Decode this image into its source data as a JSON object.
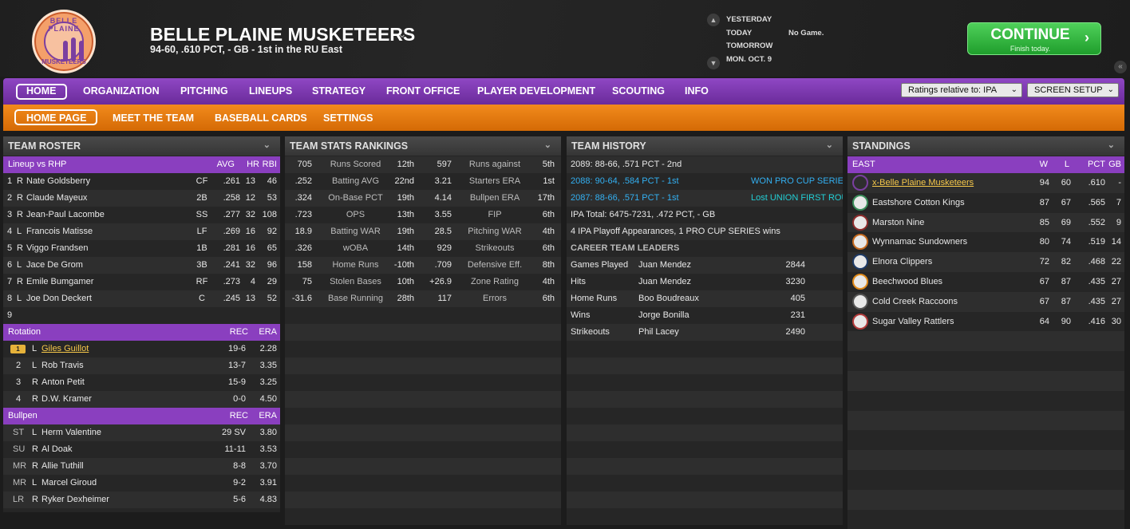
{
  "header": {
    "team_name": "BELLE PLAINE MUSKETEERS",
    "record": "94-60, .610 PCT, - GB - 1st in the RU East",
    "logo_text_top": "BELLE PLAINE",
    "logo_text_bottom": "MUSKETEERS",
    "days": [
      "YESTERDAY",
      "TODAY",
      "TOMORROW",
      "MON. OCT. 9"
    ],
    "today_status": "No Game.",
    "continue_label": "CONTINUE",
    "continue_sub": "Finish today."
  },
  "nav": {
    "main": [
      "HOME",
      "ORGANIZATION",
      "PITCHING",
      "LINEUPS",
      "STRATEGY",
      "FRONT OFFICE",
      "PLAYER DEVELOPMENT",
      "SCOUTING",
      "INFO"
    ],
    "ratings_select": "Ratings relative to: IPA",
    "screen_setup": "SCREEN SETUP",
    "sub": [
      "HOME PAGE",
      "MEET THE TEAM",
      "BASEBALL CARDS",
      "SETTINGS"
    ]
  },
  "colors": {
    "purple": "#8a3fbf",
    "orange": "#e57b10",
    "green": "#2fb53c",
    "link": "#f6c84a"
  },
  "roster": {
    "title": "TEAM ROSTER",
    "lineup_label": "Lineup vs RHP",
    "cols": [
      "AVG",
      "HR",
      "RBI"
    ],
    "lineup": [
      [
        "1",
        "R",
        "Nate Goldsberry",
        "CF",
        ".261",
        "13",
        "46"
      ],
      [
        "2",
        "R",
        "Claude Mayeux",
        "2B",
        ".258",
        "12",
        "53"
      ],
      [
        "3",
        "R",
        "Jean-Paul Lacombe",
        "SS",
        ".277",
        "32",
        "108"
      ],
      [
        "4",
        "L",
        "Francois Matisse",
        "LF",
        ".269",
        "16",
        "92"
      ],
      [
        "5",
        "R",
        "Viggo Frandsen",
        "1B",
        ".281",
        "16",
        "65"
      ],
      [
        "6",
        "L",
        "Jace De Grom",
        "3B",
        ".241",
        "32",
        "96"
      ],
      [
        "7",
        "R",
        "Emile Bumgamer",
        "RF",
        ".273",
        "4",
        "29"
      ],
      [
        "8",
        "L",
        "Joe Don Deckert",
        "C",
        ".245",
        "13",
        "52"
      ],
      [
        "9",
        "",
        "",
        "",
        "",
        "",
        ""
      ]
    ],
    "rotation_label": "Rotation",
    "rot_cols": [
      "REC",
      "ERA"
    ],
    "rotation": [
      [
        "1",
        "L",
        "Giles Guillot",
        "19-6",
        "2.28"
      ],
      [
        "2",
        "L",
        "Rob Travis",
        "13-7",
        "3.35"
      ],
      [
        "3",
        "R",
        "Anton Petit",
        "15-9",
        "3.25"
      ],
      [
        "4",
        "R",
        "D.W. Kramer",
        "0-0",
        "4.50"
      ]
    ],
    "bullpen_label": "Bullpen",
    "bullpen": [
      [
        "ST",
        "L",
        "Herm Valentine",
        "29 SV",
        "3.80"
      ],
      [
        "SU",
        "R",
        "Al Doak",
        "11-11",
        "3.53"
      ],
      [
        "MR",
        "R",
        "Allie Tuthill",
        "8-8",
        "3.70"
      ],
      [
        "MR",
        "L",
        "Marcel Giroud",
        "9-2",
        "3.91"
      ],
      [
        "LR",
        "R",
        "Ryker Dexheimer",
        "5-6",
        "4.83"
      ]
    ]
  },
  "stats": {
    "title": "TEAM STATS RANKINGS",
    "rows": [
      [
        "705",
        "Runs Scored",
        "12th",
        "597",
        "Runs against",
        "5th"
      ],
      [
        ".252",
        "Batting AVG",
        "22nd",
        "3.21",
        "Starters ERA",
        "1st"
      ],
      [
        ".324",
        "On-Base PCT",
        "19th",
        "4.14",
        "Bullpen ERA",
        "17th"
      ],
      [
        ".723",
        "OPS",
        "13th",
        "3.55",
        "FIP",
        "6th"
      ],
      [
        "18.9",
        "Batting WAR",
        "19th",
        "28.5",
        "Pitching WAR",
        "4th"
      ],
      [
        ".326",
        "wOBA",
        "14th",
        "929",
        "Strikeouts",
        "6th"
      ],
      [
        "158",
        "Home Runs",
        "-10th",
        ".709",
        "Defensive Eff.",
        "8th"
      ],
      [
        "75",
        "Stolen Bases",
        "10th",
        "+26.9",
        "Zone Rating",
        "4th"
      ],
      [
        "-31.6",
        "Base Running",
        "28th",
        "117",
        "Errors",
        "6th"
      ]
    ]
  },
  "history": {
    "title": "TEAM HISTORY",
    "seasons": [
      [
        "2089: 88-66, .571 PCT - 2nd",
        ""
      ],
      [
        "2088: 90-64, .584 PCT - 1st",
        "WON PRO CUP SERIES"
      ],
      [
        "2087: 88-66, .571 PCT - 1st",
        "Lost UNION FIRST ROU"
      ]
    ],
    "total": "IPA Total: 6475-7231, .472 PCT, - GB",
    "playoffs": "4 IPA Playoff Appearances, 1 PRO CUP SERIES wins",
    "leaders_label": "CAREER TEAM LEADERS",
    "leaders": [
      [
        "Games Played",
        "Juan Mendez",
        "2844"
      ],
      [
        "Hits",
        "Juan Mendez",
        "3230"
      ],
      [
        "Home Runs",
        "Boo Boudreaux",
        "405"
      ],
      [
        "Wins",
        "Jorge Bonilla",
        "231"
      ],
      [
        "Strikeouts",
        "Phil Lacey",
        "2490"
      ]
    ]
  },
  "standings": {
    "title": "STANDINGS",
    "division": "EAST",
    "cols": [
      "W",
      "L",
      "PCT",
      "GB"
    ],
    "teams": [
      [
        "x-Belle Plaine Musketeers",
        "94",
        "60",
        ".610",
        "-"
      ],
      [
        "Eastshore Cotton Kings",
        "87",
        "67",
        ".565",
        "7"
      ],
      [
        "Marston Nine",
        "85",
        "69",
        ".552",
        "9"
      ],
      [
        "Wynnamac Sundowners",
        "80",
        "74",
        ".519",
        "14"
      ],
      [
        "Elnora Clippers",
        "72",
        "82",
        ".468",
        "22"
      ],
      [
        "Beechwood Blues",
        "67",
        "87",
        ".435",
        "27"
      ],
      [
        "Cold Creek Raccoons",
        "67",
        "87",
        ".435",
        "27"
      ],
      [
        "Sugar Valley Rattlers",
        "64",
        "90",
        ".416",
        "30"
      ]
    ]
  }
}
